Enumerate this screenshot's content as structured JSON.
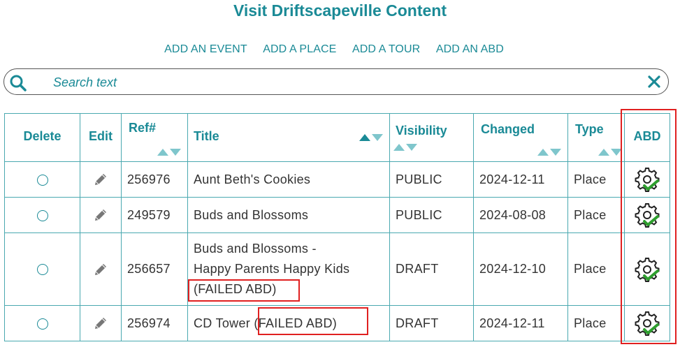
{
  "page": {
    "title": "Visit Driftscapeville Content"
  },
  "add_links": [
    "ADD AN EVENT",
    "ADD A PLACE",
    "ADD A TOUR",
    "ADD AN ABD"
  ],
  "search": {
    "placeholder": "Search text",
    "value": ""
  },
  "table": {
    "headers": {
      "delete": "Delete",
      "edit": "Edit",
      "ref": "Ref#",
      "title": "Title",
      "visibility": "Visibility",
      "changed": "Changed",
      "type": "Type",
      "abd": "ABD"
    },
    "rows": [
      {
        "ref": "256976",
        "title": "Aunt Beth's Cookies",
        "visibility": "PUBLIC",
        "changed": "2024-12-11",
        "type": "Place"
      },
      {
        "ref": "249579",
        "title": "Buds and Blossoms",
        "visibility": "PUBLIC",
        "changed": "2024-08-08",
        "type": "Place"
      },
      {
        "ref": "256657",
        "title_line1": "Buds and Blossoms -",
        "title_line2": "Happy Parents Happy Kids",
        "title_line3": "(FAILED ABD)",
        "visibility": "DRAFT",
        "changed": "2024-12-10",
        "type": "Place"
      },
      {
        "ref": "256974",
        "title_main": "CD Tower",
        "title_failed": "(FAILED ABD)",
        "visibility": "DRAFT",
        "changed": "2024-12-11",
        "type": "Place"
      }
    ]
  },
  "icons": {
    "search": "search-icon",
    "clear": "close-icon",
    "edit": "pencil-icon",
    "abd": "gear-check-icon",
    "sort": "sort-arrows-icon"
  },
  "colors": {
    "accent": "#1a8a96",
    "sort_inactive": "#7fc6cc",
    "highlight": "#e02020",
    "check": "#2e9e2e"
  }
}
